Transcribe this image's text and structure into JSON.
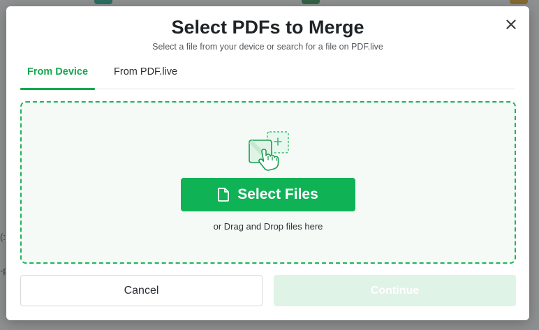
{
  "modal": {
    "title": "Select PDFs to Merge",
    "subtitle": "Select a file from your device or search for a file on PDF.live",
    "close_icon": "close-icon"
  },
  "tabs": [
    {
      "label": "From Device",
      "active": true
    },
    {
      "label": "From PDF.live",
      "active": false
    }
  ],
  "dropzone": {
    "illustration_icon": "hand-tap-upload-icon",
    "select_button": {
      "label": "Select Files",
      "icon": "file-icon"
    },
    "hint": "or Drag and Drop files here"
  },
  "footer": {
    "cancel_label": "Cancel",
    "continue_label": "Continue",
    "continue_enabled": false
  },
  "background": {
    "text_fragments": [
      "(:",
      "-p"
    ]
  },
  "colors": {
    "accent": "#14a84f",
    "button_green": "#0fb356",
    "disabled_green": "#dff3e6",
    "dropzone_border": "#1db45a"
  }
}
